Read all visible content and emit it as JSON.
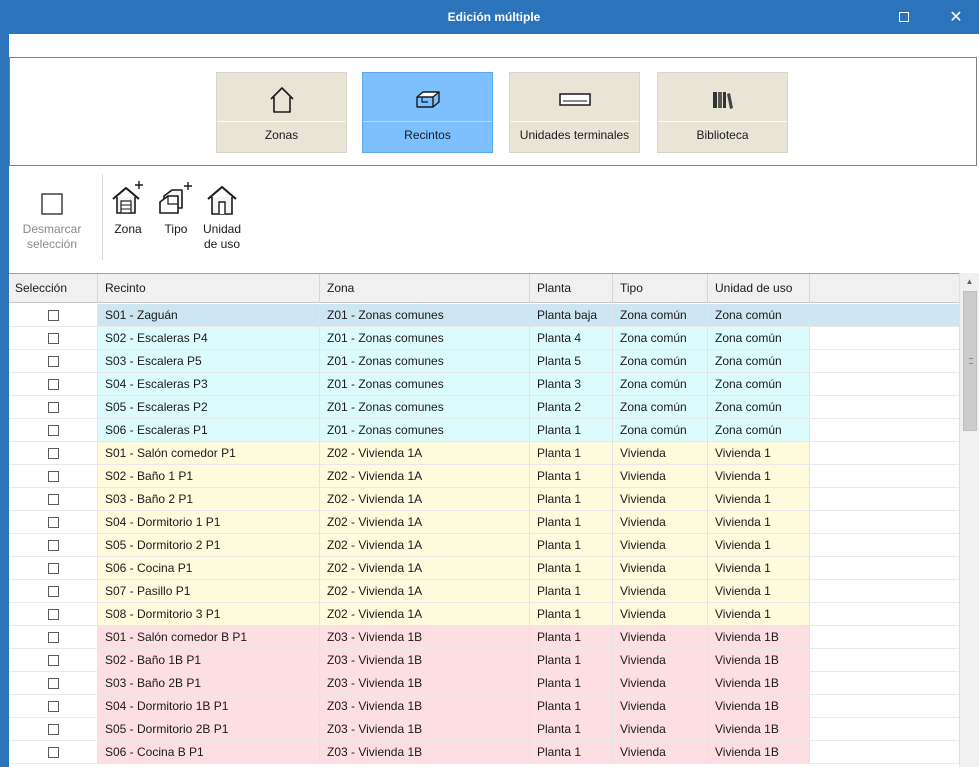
{
  "window": {
    "title": "Edición múltiple",
    "maximize_icon": "maximize-icon",
    "close_icon": "close-icon",
    "close_glyph": "✕"
  },
  "modes": [
    {
      "label": "Zonas",
      "icon": "house-icon",
      "active": false
    },
    {
      "label": "Recintos",
      "icon": "room-icon",
      "active": true
    },
    {
      "label": "Unidades terminales",
      "icon": "terminal-unit-icon",
      "active": false
    },
    {
      "label": "Biblioteca",
      "icon": "library-icon",
      "active": false
    }
  ],
  "toolbar": {
    "deselect": {
      "label_line1": "Desmarcar",
      "label_line2": "selección",
      "icon": "checkbox-icon",
      "enabled": false
    },
    "zona": {
      "label": "Zona",
      "icon": "zone-add-icon"
    },
    "tipo": {
      "label": "Tipo",
      "icon": "type-add-icon"
    },
    "unidad": {
      "label_line1": "Unidad",
      "label_line2": "de uso",
      "icon": "use-unit-icon"
    }
  },
  "colors": {
    "titlebar": "#2b73ba",
    "active_mode": "#7cc0ff",
    "mode_bg": "#e8e4d6",
    "zone_comunes": "#dcfbfd",
    "zone_1a": "#fdfbdb",
    "zone_1b": "#fddfe3",
    "selected_row": "#cde6f1"
  },
  "table": {
    "columns": [
      "Selección",
      "Recinto",
      "Zona",
      "Planta",
      "Tipo",
      "Unidad de uso"
    ],
    "rows": [
      {
        "recinto": "S01 - Zaguán",
        "zona": "Z01 - Zonas comunes",
        "planta": "Planta baja",
        "tipo": "Zona común",
        "unidad": "Zona común",
        "group": "comunes",
        "selected": true
      },
      {
        "recinto": "S02 - Escaleras P4",
        "zona": "Z01 - Zonas comunes",
        "planta": "Planta 4",
        "tipo": "Zona común",
        "unidad": "Zona común",
        "group": "comunes"
      },
      {
        "recinto": "S03 - Escalera P5",
        "zona": "Z01 - Zonas comunes",
        "planta": "Planta 5",
        "tipo": "Zona común",
        "unidad": "Zona común",
        "group": "comunes"
      },
      {
        "recinto": "S04 - Escaleras P3",
        "zona": "Z01 - Zonas comunes",
        "planta": "Planta 3",
        "tipo": "Zona común",
        "unidad": "Zona común",
        "group": "comunes"
      },
      {
        "recinto": "S05 - Escaleras P2",
        "zona": "Z01 - Zonas comunes",
        "planta": "Planta 2",
        "tipo": "Zona común",
        "unidad": "Zona común",
        "group": "comunes"
      },
      {
        "recinto": "S06 - Escaleras P1",
        "zona": "Z01 - Zonas comunes",
        "planta": "Planta 1",
        "tipo": "Zona común",
        "unidad": "Zona común",
        "group": "comunes"
      },
      {
        "recinto": "S01 - Salón comedor P1",
        "zona": "Z02 - Vivienda 1A",
        "planta": "Planta 1",
        "tipo": "Vivienda",
        "unidad": "Vivienda 1",
        "group": "v1a"
      },
      {
        "recinto": "S02 - Baño 1 P1",
        "zona": "Z02 - Vivienda 1A",
        "planta": "Planta 1",
        "tipo": "Vivienda",
        "unidad": "Vivienda 1",
        "group": "v1a"
      },
      {
        "recinto": "S03 - Baño 2 P1",
        "zona": "Z02 - Vivienda 1A",
        "planta": "Planta 1",
        "tipo": "Vivienda",
        "unidad": "Vivienda 1",
        "group": "v1a"
      },
      {
        "recinto": "S04 - Dormitorio 1 P1",
        "zona": "Z02 - Vivienda 1A",
        "planta": "Planta 1",
        "tipo": "Vivienda",
        "unidad": "Vivienda 1",
        "group": "v1a"
      },
      {
        "recinto": "S05 - Dormitorio 2 P1",
        "zona": "Z02 - Vivienda 1A",
        "planta": "Planta 1",
        "tipo": "Vivienda",
        "unidad": "Vivienda 1",
        "group": "v1a"
      },
      {
        "recinto": "S06 - Cocina P1",
        "zona": "Z02 - Vivienda 1A",
        "planta": "Planta 1",
        "tipo": "Vivienda",
        "unidad": "Vivienda 1",
        "group": "v1a"
      },
      {
        "recinto": "S07 - Pasillo P1",
        "zona": "Z02 - Vivienda 1A",
        "planta": "Planta 1",
        "tipo": "Vivienda",
        "unidad": "Vivienda 1",
        "group": "v1a"
      },
      {
        "recinto": "S08 - Dormitorio 3 P1",
        "zona": "Z02 - Vivienda 1A",
        "planta": "Planta 1",
        "tipo": "Vivienda",
        "unidad": "Vivienda 1",
        "group": "v1a"
      },
      {
        "recinto": "S01 - Salón comedor B P1",
        "zona": "Z03 - Vivienda 1B",
        "planta": "Planta 1",
        "tipo": "Vivienda",
        "unidad": "Vivienda 1B",
        "group": "v1b"
      },
      {
        "recinto": "S02 - Baño 1B P1",
        "zona": "Z03 - Vivienda 1B",
        "planta": "Planta 1",
        "tipo": "Vivienda",
        "unidad": "Vivienda 1B",
        "group": "v1b"
      },
      {
        "recinto": "S03 - Baño 2B P1",
        "zona": "Z03 - Vivienda 1B",
        "planta": "Planta 1",
        "tipo": "Vivienda",
        "unidad": "Vivienda 1B",
        "group": "v1b"
      },
      {
        "recinto": "S04 - Dormitorio 1B P1",
        "zona": "Z03 - Vivienda 1B",
        "planta": "Planta 1",
        "tipo": "Vivienda",
        "unidad": "Vivienda 1B",
        "group": "v1b"
      },
      {
        "recinto": "S05 - Dormitorio 2B P1",
        "zona": "Z03 - Vivienda 1B",
        "planta": "Planta 1",
        "tipo": "Vivienda",
        "unidad": "Vivienda 1B",
        "group": "v1b"
      },
      {
        "recinto": "S06 - Cocina B P1",
        "zona": "Z03 - Vivienda 1B",
        "planta": "Planta 1",
        "tipo": "Vivienda",
        "unidad": "Vivienda 1B",
        "group": "v1b"
      }
    ]
  },
  "scrollbar": {
    "up_icon": "scroll-up-arrow-icon",
    "up_glyph": "▲"
  }
}
